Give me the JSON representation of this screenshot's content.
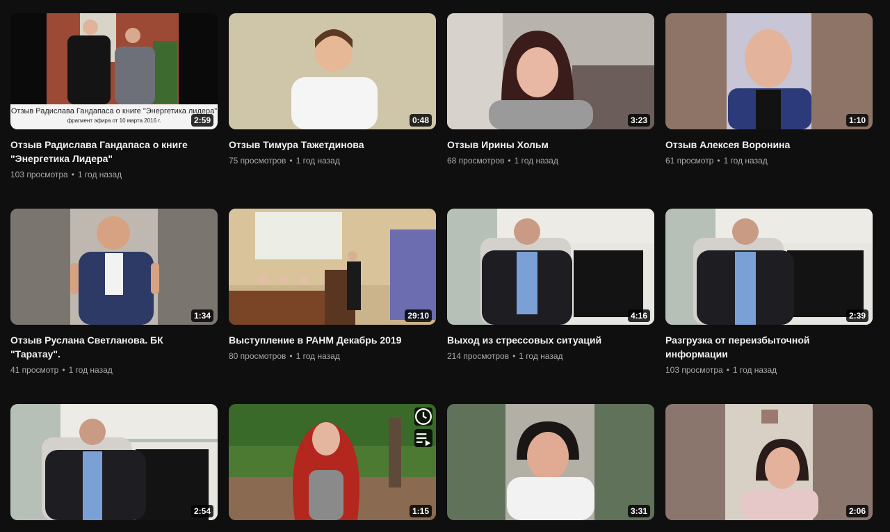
{
  "videos": [
    {
      "title": "Отзыв Радислава Гандапаса о книге \"Энергетика Лидера\"",
      "views": "103 просмотра",
      "age": "1 год назад",
      "duration": "2:59",
      "caption_line1": "Отзыв Радислава Гандапаса о книге \"Энергетика лидера\"",
      "caption_line2": "фрагмент эфира от 10 марта 2016 г."
    },
    {
      "title": "Отзыв Тимура Тажетдинова",
      "views": "75 просмотров",
      "age": "1 год назад",
      "duration": "0:48"
    },
    {
      "title": "Отзыв Ирины Хольм",
      "views": "68 просмотров",
      "age": "1 год назад",
      "duration": "3:23"
    },
    {
      "title": "Отзыв Алексея Воронина",
      "views": "61 просмотр",
      "age": "1 год назад",
      "duration": "1:10"
    },
    {
      "title": "Отзыв Руслана Светланова. БК \"Таратау\".",
      "views": "41 просмотр",
      "age": "1 год назад",
      "duration": "1:34"
    },
    {
      "title": "Выступление в РАНМ Декабрь 2019",
      "views": "80 просмотров",
      "age": "1 год назад",
      "duration": "29:10"
    },
    {
      "title": "Выход из стрессовых ситуаций",
      "views": "214 просмотров",
      "age": "1 год назад",
      "duration": "4:16"
    },
    {
      "title": "Разгрузка от переизбыточной информации",
      "views": "103 просмотра",
      "age": "1 год назад",
      "duration": "2:39"
    },
    {
      "duration": "2:54"
    },
    {
      "duration": "1:15"
    },
    {
      "duration": "3:31"
    },
    {
      "duration": "2:06"
    }
  ],
  "separator": "•",
  "hover_icons": [
    "clock-icon",
    "add-to-queue-icon"
  ]
}
